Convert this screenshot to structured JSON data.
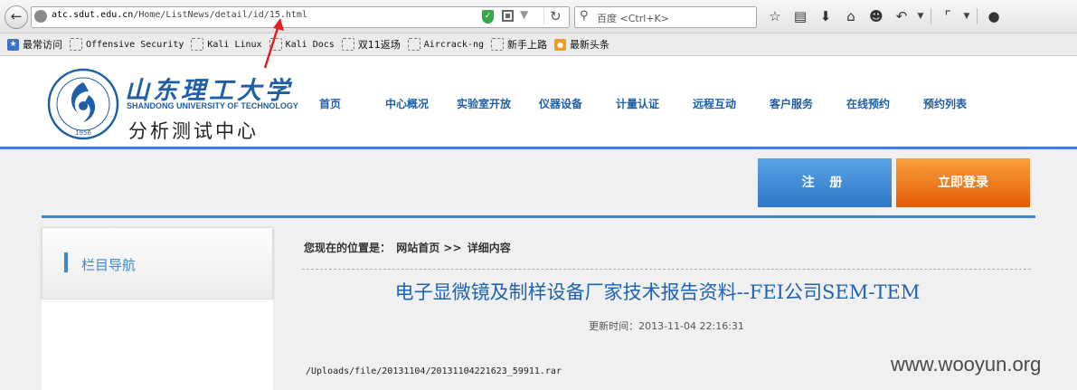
{
  "browser": {
    "url_host": "atc.sdut.edu.cn",
    "url_path": "/Home/ListNews/detail/id/15.html",
    "search_placeholder": "百度 <Ctrl+K>",
    "bookmarks": [
      {
        "label": "最常访问",
        "icon": "bookmark-star-icon"
      },
      {
        "label": "Offensive Security",
        "icon": "folder-icon"
      },
      {
        "label": "Kali Linux",
        "icon": "folder-icon"
      },
      {
        "label": "Kali Docs",
        "icon": "folder-icon"
      },
      {
        "label": "双11返场",
        "icon": "folder-icon"
      },
      {
        "label": "Aircrack-ng",
        "icon": "folder-icon"
      },
      {
        "label": "新手上路",
        "icon": "folder-icon"
      },
      {
        "label": "最新头条",
        "icon": "rss-icon"
      }
    ]
  },
  "site": {
    "logo_cn": "山东理工大学",
    "logo_en": "SHANDONG UNIVERSITY OF TECHNOLOGY",
    "logo_sub": "分析测试中心",
    "emblem_year": "1956",
    "nav": [
      "首页",
      "中心概况",
      "实验室开放",
      "仪器设备",
      "计量认证",
      "远程互动",
      "客户服务",
      "在线预约",
      "预约列表"
    ]
  },
  "account": {
    "register_label": "注 册",
    "login_label": "立即登录"
  },
  "sidebar": {
    "title": "栏目导航"
  },
  "breadcrumb": {
    "prefix": "您现在的位置是：",
    "home": "网站首页",
    "separator": ">>",
    "current": "详细内容"
  },
  "article": {
    "title": "电子显微镜及制样设备厂家技术报告资料--FEI公司SEM-TEM",
    "updated": "更新时间：2013-11-04 22:16:31",
    "file_link": "/Uploads/file/20131104/20131104221623_59911.rar"
  },
  "watermark": "www.wooyun.org",
  "colors": {
    "brand_blue": "#1f5fa6",
    "accent_blue": "#3e86cc",
    "register_button": "#3f8ad6",
    "login_button": "#ee7a1e",
    "annotation_red": "#e02020"
  }
}
